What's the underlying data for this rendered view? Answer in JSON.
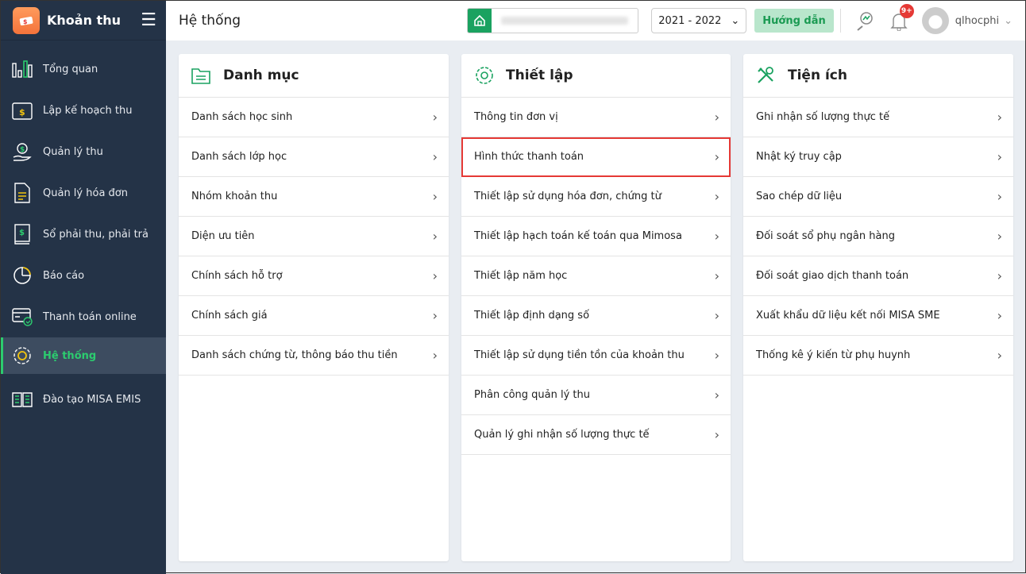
{
  "app": {
    "title": "Khoản thu"
  },
  "sidebar": {
    "items": [
      {
        "label": "Tổng quan",
        "icon": "bar-chart-icon"
      },
      {
        "label": "Lập kế hoạch thu",
        "icon": "calendar-dollar-icon"
      },
      {
        "label": "Quản lý thu",
        "icon": "hand-coin-icon"
      },
      {
        "label": "Quản lý hóa đơn",
        "icon": "invoice-icon"
      },
      {
        "label": "Sổ phải thu, phải trả",
        "icon": "ledger-icon"
      },
      {
        "label": "Báo cáo",
        "icon": "pie-chart-icon"
      },
      {
        "label": "Thanh toán online",
        "icon": "card-check-icon"
      },
      {
        "label": "Hệ thống",
        "icon": "gear-icon",
        "active": true
      },
      {
        "label": "Đào tạo MISA EMIS",
        "icon": "book-icon"
      }
    ]
  },
  "header": {
    "title": "Hệ thống",
    "year": "2021 - 2022",
    "guide": "Hướng dẫn",
    "badge": "9+",
    "user": "qlhocphi"
  },
  "cards": [
    {
      "title": "Danh mục",
      "items": [
        "Danh sách học sinh",
        "Danh sách lớp học",
        "Nhóm khoản thu",
        "Diện ưu tiên",
        "Chính sách hỗ trợ",
        "Chính sách giá",
        "Danh sách chứng từ, thông báo thu tiền"
      ]
    },
    {
      "title": "Thiết lập",
      "items": [
        "Thông tin đơn vị",
        "Hình thức thanh toán",
        "Thiết lập sử dụng hóa đơn, chứng từ",
        "Thiết lập hạch toán kế toán qua Mimosa",
        "Thiết lập năm học",
        "Thiết lập định dạng số",
        "Thiết lập sử dụng tiền tồn của khoản thu",
        "Phân công quản lý thu",
        "Quản lý ghi nhận số lượng thực tế"
      ]
    },
    {
      "title": "Tiện ích",
      "items": [
        "Ghi nhận số lượng thực tế",
        "Nhật ký truy cập",
        "Sao chép dữ liệu",
        "Đối soát sổ phụ ngân hàng",
        "Đối soát giao dịch thanh toán",
        "Xuất khẩu dữ liệu kết nối MISA SME",
        "Thống kê ý kiến từ phụ huynh"
      ]
    }
  ],
  "colors": {
    "sidebar": "#243347",
    "accent": "#2ccc6f",
    "highlight": "#e53935"
  }
}
